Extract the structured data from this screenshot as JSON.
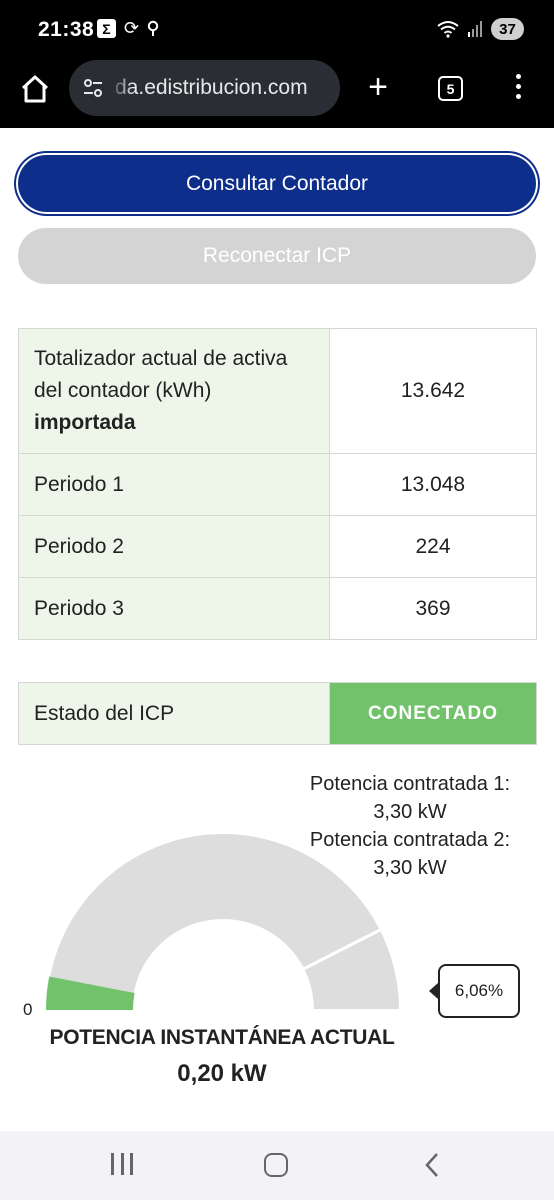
{
  "status_bar": {
    "time": "21:38",
    "battery": "37",
    "icons": [
      "sigma-icon",
      "sync-icon",
      "location-icon",
      "wifi-icon",
      "signal-icon"
    ]
  },
  "browser": {
    "url": "da.edistribucion.com",
    "tab_count": "5",
    "plus_label": "+"
  },
  "actions": {
    "consult_label": "Consultar Contador",
    "reconnect_label": "Reconectar ICP"
  },
  "meter_table": {
    "total_label_part1": "Totalizador actual de activa del contador (kWh)",
    "total_label_part2": "importada",
    "total_value": "13.642",
    "rows": [
      {
        "label": "Periodo 1",
        "value": "13.048"
      },
      {
        "label": "Periodo 2",
        "value": "224"
      },
      {
        "label": "Periodo 3",
        "value": "369"
      }
    ]
  },
  "icp": {
    "label": "Estado del ICP",
    "status": "CONECTADO",
    "status_color": "#71c26a"
  },
  "power": {
    "contracted_1_label": "Potencia contratada 1:",
    "contracted_1_value": "3,30 kW",
    "contracted_2_label": "Potencia contratada 2:",
    "contracted_2_value": "3,30 kW",
    "gauge_min": "0",
    "tooltip": "6,06%",
    "fill_fraction": 0.0606,
    "title": "POTENCIA INSTANTÁNEA ACTUAL",
    "value": "0,20 kW",
    "fill_color": "#71c26a",
    "track_color": "#dddddd"
  }
}
